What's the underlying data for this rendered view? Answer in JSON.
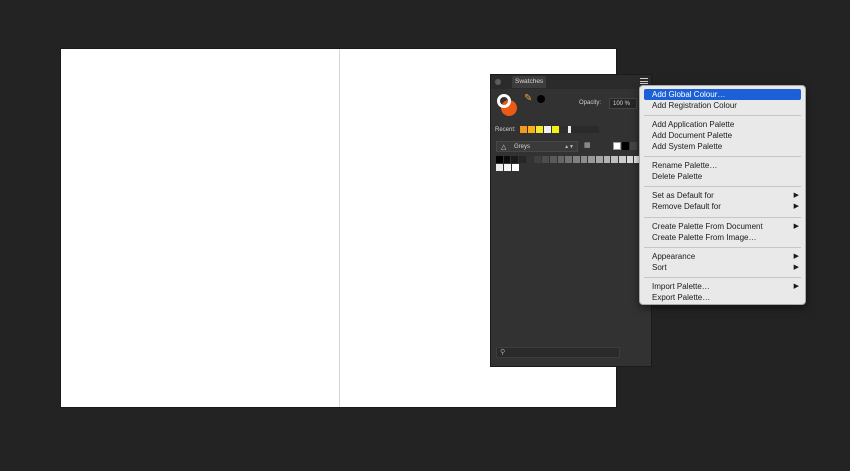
{
  "panel": {
    "tab_label": "Swatches",
    "opacity_label": "Opacity:",
    "opacity_value": "100 %",
    "recent_label": "Recent:",
    "recent_swatches": [
      "#f39a1e",
      "#f7b21b",
      "#f4ea2b",
      "#f0f0f0",
      "#f6ef16",
      "#2d2d2d",
      "#ececec"
    ],
    "palette_name": "Greys",
    "grays_row1": [
      "#000000",
      "#0d0d0d",
      "#1a1a1a",
      "#262626",
      "#333333",
      "#404040",
      "#4d4d4d",
      "#595959",
      "#666666",
      "#737373",
      "#808080",
      "#8c8c8c",
      "#999999",
      "#a6a6a6",
      "#b3b3b3",
      "#bfbfbf",
      "#cccccc",
      "#d9d9d9",
      "#e6e6e6"
    ],
    "grays_row2": [
      "#ececec",
      "#f5f5f5",
      "#ffffff"
    ],
    "fill_color": "#e85a16",
    "stroke_color": "#ffffff"
  },
  "menu": {
    "items": [
      {
        "label": "Add Global Colour…",
        "submenu": false,
        "selected": true
      },
      {
        "label": "Add Registration Colour",
        "submenu": false
      },
      {
        "label": "Add Application Palette",
        "submenu": false
      },
      {
        "label": "Add Document Palette",
        "submenu": false
      },
      {
        "label": "Add System Palette",
        "submenu": false
      },
      {
        "label": "Rename Palette…",
        "submenu": false
      },
      {
        "label": "Delete Palette",
        "submenu": false
      },
      {
        "label": "Set as Default for",
        "submenu": true
      },
      {
        "label": "Remove Default for",
        "submenu": true
      },
      {
        "label": "Create Palette From Document",
        "submenu": true
      },
      {
        "label": "Create Palette From Image…",
        "submenu": false
      },
      {
        "label": "Appearance",
        "submenu": true
      },
      {
        "label": "Sort",
        "submenu": true
      },
      {
        "label": "Import Palette…",
        "submenu": true
      },
      {
        "label": "Export Palette…",
        "submenu": false
      }
    ],
    "selected_color": "#1b60d6"
  }
}
